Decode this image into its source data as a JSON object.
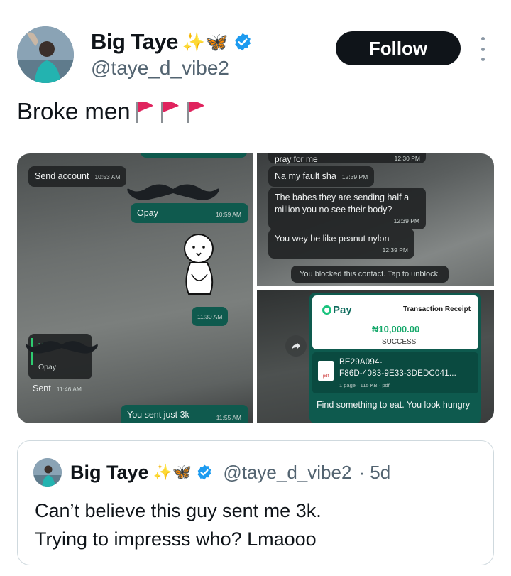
{
  "author": {
    "display_name": "Big Taye",
    "emoji": "✨🦋",
    "handle": "@taye_d_vibe2",
    "verified_color": "#1d9bf0"
  },
  "follow_label": "Follow",
  "tweet": {
    "text": "Broke men",
    "flag_color": "#e0245e"
  },
  "media": {
    "left_chat": {
      "msg1": {
        "text": "Send account",
        "time": "10:53 AM"
      },
      "msg2": {
        "text": "Opay",
        "time": "10:59 AM"
      },
      "drawing_time": "11:30 AM",
      "reply_quote_name": "You",
      "reply_quote_text": "Opay",
      "msg3": {
        "text": "Sent",
        "time": "11:46 AM"
      },
      "msg4": {
        "text": "You sent just 3k",
        "time": "11:55 AM"
      }
    },
    "right_chat": {
      "msg0": {
        "text": "pray for me",
        "time": "12:30 PM"
      },
      "msg1": {
        "text": "Na my fault sha",
        "time": "12:39 PM"
      },
      "msg2": {
        "text": "The babes they are sending half a million you no see their body?",
        "time": "12:39 PM"
      },
      "msg3": {
        "text": "You wey be like peanut nylon",
        "time": "12:39 PM"
      },
      "blocked_note": "You blocked this contact. Tap to unblock."
    },
    "receipt": {
      "brand": "Pay",
      "title": "Transaction Receipt",
      "amount": "₦10,000.00",
      "status": "SUCCESS",
      "file_line1": "BE29A094-",
      "file_line2": "F86D-4083-9E33-3DEDC041...",
      "file_meta": "1 page · 115 KB · pdf",
      "pdf_label": "pdf",
      "caption": "Find something to eat. You look hungry"
    }
  },
  "quote": {
    "display_name": "Big Taye",
    "emoji": "✨🦋",
    "handle": "@taye_d_vibe2",
    "age": "· 5d",
    "line1": "Can’t believe this guy sent me 3k.",
    "line2": "Trying to impresss who? Lmaooo"
  }
}
